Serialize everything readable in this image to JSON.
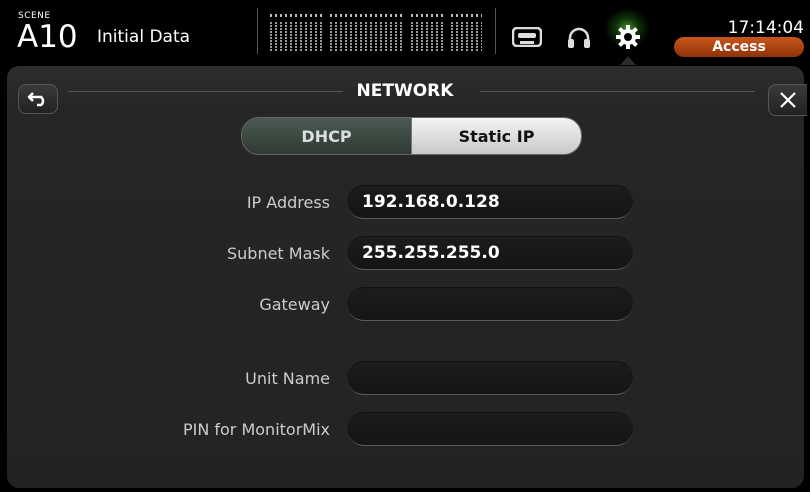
{
  "header": {
    "scene_label": "SCENE",
    "scene_number": "A10",
    "scene_name": "Initial Data",
    "clock": "17:14:04",
    "access_label": "Access",
    "icons": [
      "recorder-icon",
      "headphones-icon",
      "gear-icon"
    ]
  },
  "panel": {
    "title": "NETWORK",
    "mode_options": [
      "DHCP",
      "Static IP"
    ],
    "mode_selected": "Static IP",
    "fields": {
      "ip_address": {
        "label": "IP Address",
        "value": "192.168.0.128"
      },
      "subnet_mask": {
        "label": "Subnet Mask",
        "value": "255.255.255.0"
      },
      "gateway": {
        "label": "Gateway",
        "value": ""
      },
      "unit_name": {
        "label": "Unit Name",
        "value": ""
      },
      "pin_monitormix": {
        "label": "PIN for MonitorMix",
        "value": ""
      }
    }
  },
  "colors": {
    "accent_access": "#b5460f",
    "gear_glow": "#78ff50",
    "panel_bg": "#262626"
  }
}
